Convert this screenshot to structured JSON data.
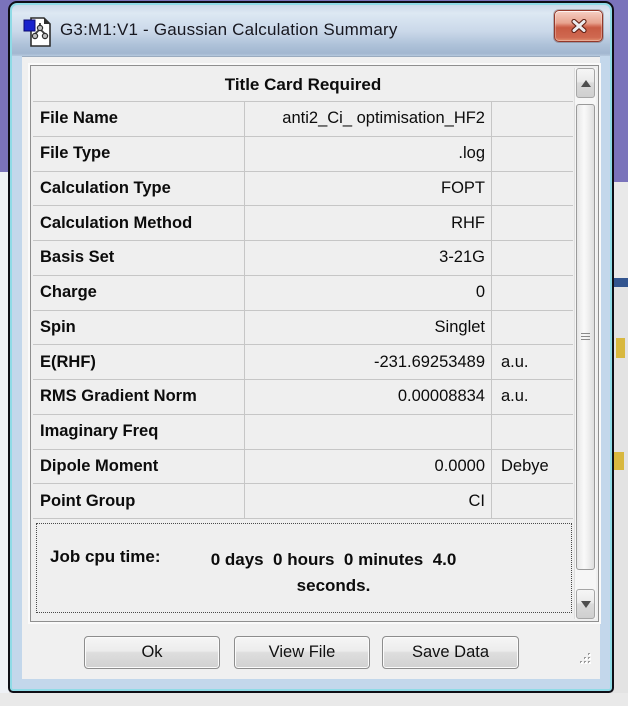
{
  "window": {
    "title": "G3:M1:V1 - Gaussian Calculation Summary",
    "app_icon": "gaussview-molecule-document-icon",
    "close_icon": "x-close-icon"
  },
  "summary_table": {
    "header": "Title Card Required",
    "rows": [
      {
        "label": "File Name",
        "value": "anti2_Ci_ optimisation_HF2",
        "unit": ""
      },
      {
        "label": "File Type",
        "value": ".log",
        "unit": ""
      },
      {
        "label": "Calculation Type",
        "value": "FOPT",
        "unit": ""
      },
      {
        "label": "Calculation Method",
        "value": "RHF",
        "unit": ""
      },
      {
        "label": "Basis Set",
        "value": "3-21G",
        "unit": ""
      },
      {
        "label": "Charge",
        "value": "0",
        "unit": ""
      },
      {
        "label": "Spin",
        "value": "Singlet",
        "unit": ""
      },
      {
        "label": "E(RHF)",
        "value": "-231.69253489",
        "unit": "a.u."
      },
      {
        "label": "RMS Gradient Norm",
        "value": "0.00008834",
        "unit": "a.u."
      },
      {
        "label": "Imaginary Freq",
        "value": "",
        "unit": ""
      },
      {
        "label": "Dipole Moment",
        "value": "0.0000",
        "unit": "Debye"
      },
      {
        "label": "Point Group",
        "value": "CI",
        "unit": ""
      }
    ]
  },
  "job_cpu": {
    "label": "Job cpu time:",
    "value": "0 days  0 hours  0 minutes  4.0 seconds."
  },
  "buttons": {
    "ok": "Ok",
    "view_file": "View File",
    "save_data": "Save Data"
  },
  "scrollbar_icons": {
    "up": "triangle-up-icon",
    "down": "triangle-down-icon"
  },
  "colors": {
    "titlebar_top": "#dde8f3",
    "titlebar_bottom": "#a2b7d0",
    "aero_frame": "#c3d7eb",
    "frame_accent_cyan": "#8fdbe6",
    "close_button_red": "#c85b43",
    "client_bg": "#f0f0f0",
    "grid_line": "#c6c6c6",
    "background_purple": "#7a73bb"
  }
}
